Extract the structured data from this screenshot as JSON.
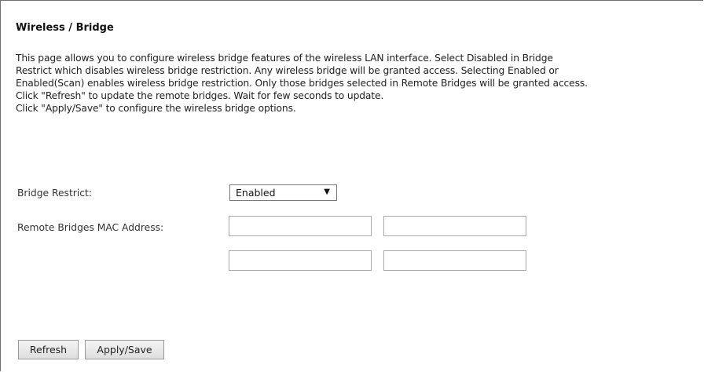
{
  "page": {
    "title": "Wireless / Bridge",
    "description_lines": [
      "This page allows you to configure wireless bridge features of the wireless LAN interface. Select Disabled in Bridge",
      "Restrict which disables wireless bridge restriction. Any wireless bridge will be granted access. Selecting Enabled or",
      "Enabled(Scan) enables wireless bridge restriction. Only those bridges selected in Remote Bridges will be granted access.",
      "Click \"Refresh\" to update the remote bridges. Wait for few seconds to update.",
      "Click \"Apply/Save\" to configure the wireless bridge options."
    ]
  },
  "form": {
    "bridge_restrict": {
      "label": "Bridge Restrict:",
      "selected": "Enabled",
      "arrow_icon": "▼"
    },
    "remote_bridges": {
      "label": "Remote Bridges MAC Address:",
      "fields": [
        "",
        "",
        "",
        ""
      ]
    }
  },
  "buttons": {
    "refresh": "Refresh",
    "apply_save": "Apply/Save"
  }
}
